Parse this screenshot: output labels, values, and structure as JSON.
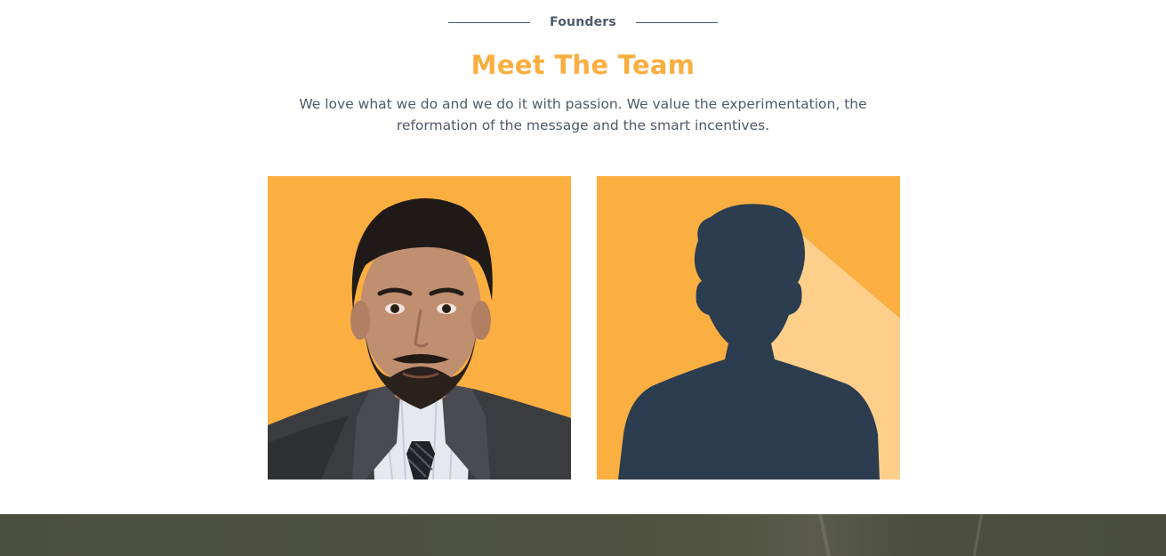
{
  "section": {
    "eyebrow": "Founders",
    "title": "Meet The Team",
    "description": "We love what we do and we do it with passion. We value the experimentation, the reformation of the message and the smart incentives."
  },
  "team": [
    {
      "photo": "founder-photo",
      "background_color": "#fbaf41"
    },
    {
      "photo": "silhouette-placeholder",
      "background_color": "#fbaf41",
      "silhouette_color": "#2b3d4f"
    }
  ],
  "colors": {
    "accent": "#f9ae3f",
    "text": "#4e5a68",
    "footer_band": "#4b4f3f"
  }
}
